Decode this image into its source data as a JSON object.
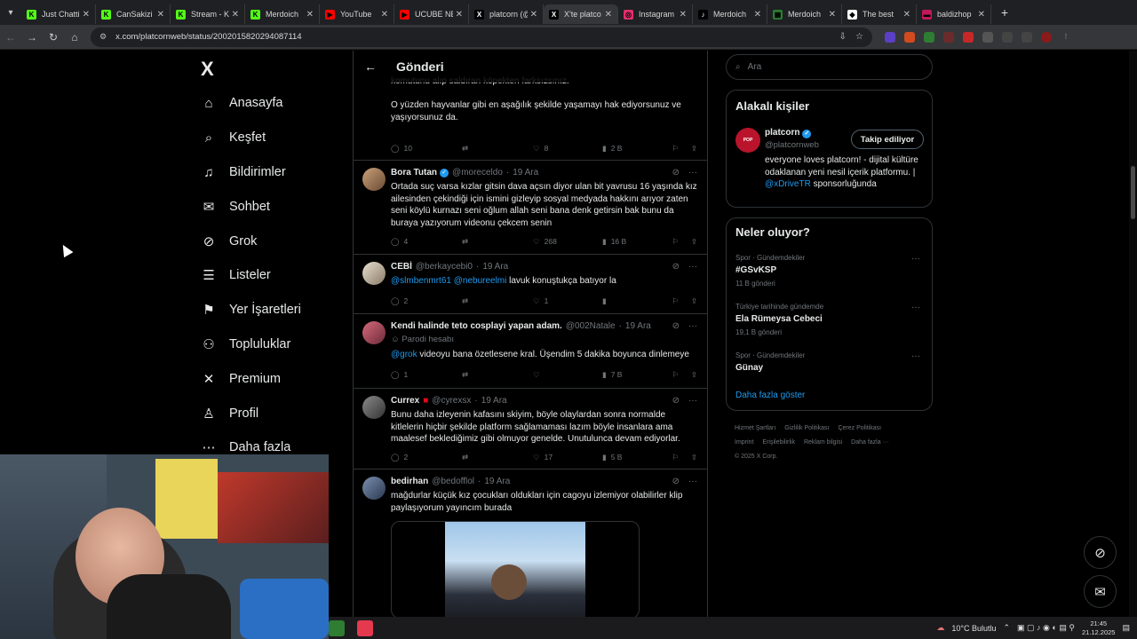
{
  "browser": {
    "tabs": [
      {
        "label": "Just Chatti",
        "color": "#53fc18",
        "icon": "K"
      },
      {
        "label": "CanSakizi",
        "color": "#53fc18",
        "icon": "K"
      },
      {
        "label": "Stream - K",
        "color": "#53fc18",
        "icon": "K"
      },
      {
        "label": "Merdoich",
        "color": "#53fc18",
        "icon": "K"
      },
      {
        "label": "YouTube",
        "color": "#ff0000",
        "icon": "▶"
      },
      {
        "label": "UCUBE NE",
        "color": "#ff0000",
        "icon": "▶"
      },
      {
        "label": "platcorn (@",
        "color": "#000000",
        "icon": "X"
      },
      {
        "label": "X'te platco",
        "color": "#000000",
        "icon": "X"
      },
      {
        "label": "Instagram",
        "color": "#e1306c",
        "icon": "◎"
      },
      {
        "label": "Merdoich",
        "color": "#000000",
        "icon": "♪"
      },
      {
        "label": "Merdoich",
        "color": "#2e7d32",
        "icon": "▦"
      },
      {
        "label": "The best",
        "color": "#ffffff",
        "icon": "◆"
      },
      {
        "label": "baldizhop",
        "color": "#c2185b",
        "icon": "▬"
      }
    ],
    "url": "x.com/platcornweb/status/2002015820294087114"
  },
  "nav": {
    "logo": "X",
    "items": [
      {
        "label": "Anasayfa",
        "icon": "home-icon",
        "glyph": "⌂"
      },
      {
        "label": "Keşfet",
        "icon": "search-icon",
        "glyph": "⌕"
      },
      {
        "label": "Bildirimler",
        "icon": "bell-icon",
        "glyph": "♫"
      },
      {
        "label": "Sohbet",
        "icon": "mail-icon",
        "glyph": "✉"
      },
      {
        "label": "Grok",
        "icon": "grok-icon",
        "glyph": "⊘"
      },
      {
        "label": "Listeler",
        "icon": "list-icon",
        "glyph": "☰"
      },
      {
        "label": "Yer İşaretleri",
        "icon": "bookmark-icon",
        "glyph": "⚑"
      },
      {
        "label": "Topluluklar",
        "icon": "communities-icon",
        "glyph": "⚇"
      },
      {
        "label": "Premium",
        "icon": "x-premium-icon",
        "glyph": "✕"
      },
      {
        "label": "Profil",
        "icon": "profile-icon",
        "glyph": "♙"
      },
      {
        "label": "Daha fazla",
        "icon": "more-icon",
        "glyph": "⋯"
      }
    ]
  },
  "main": {
    "header_title": "Gönderi",
    "prev_tweet_text": "komutunu alıp saldıran köpekten farksızsınız.\n\nO yüzden hayvanlar gibi en aşağılık şekilde yaşamayı hak ediyorsunuz ve yaşıyorsunuz da.",
    "prev_actions": {
      "replies": "10",
      "reposts": "",
      "likes": "8",
      "views": "2 B"
    },
    "tweets": [
      {
        "name": "Bora Tutan",
        "verified": true,
        "handle": "@moreceldo",
        "date": "19 Ara",
        "text": "Ortada suç varsa kızlar gitsin dava açsın diyor ulan bit yavrusu 16 yaşında kız ailesinden çekindiği için ismini gizleyip sosyal medyada hakkını arıyor zaten seni köylü kurnazı seni oğlum allah seni bana denk getirsin bak bunu da buraya yazıyorum videonu çekcem senin",
        "replies": "4",
        "reposts": "",
        "likes": "268",
        "views": "16 B"
      },
      {
        "name": "CEBİ",
        "verified": false,
        "handle": "@berkaycebi0",
        "date": "19 Ara",
        "mentions": "@slmbenmrt61 @nebureelmi",
        "text": " lavuk konuştukça batıyor la",
        "replies": "2",
        "reposts": "",
        "likes": "1",
        "views": ""
      },
      {
        "name": "Kendi halinde teto cosplayi yapan adam.",
        "verified": false,
        "handle": "@002Natale",
        "date": "19 Ara",
        "parody": "Parodi hesabı",
        "mentions": "@grok",
        "text": " videoyu bana özetlesene kral. Üşendim 5 dakika boyunca dinlemeye",
        "replies": "1",
        "reposts": "",
        "likes": "",
        "views": "7 B"
      },
      {
        "name": "Currex",
        "verified": false,
        "handle": "@cyrexsx",
        "date": "19 Ara",
        "text": "Bunu daha izleyenin kafasını skiyim, böyle olaylardan sonra normalde kitlelerin hiçbir şekilde platform sağlamaması lazım böyle insanlara ama maalesef beklediğimiz gibi olmuyor genelde. Unutulunca devam ediyorlar.",
        "replies": "2",
        "reposts": "",
        "likes": "17",
        "views": "5 B"
      },
      {
        "name": "bedirhan",
        "verified": false,
        "handle": "@bedofflol",
        "date": "19 Ara",
        "text": "mağdurlar küçük kız çocukları oldukları için cagoyu izlemiyor olabilirler klip paylaşıyorum yayıncım burada"
      }
    ]
  },
  "right": {
    "search_placeholder": "Ara",
    "related_title": "Alakalı kişiler",
    "person": {
      "name": "platcorn",
      "handle": "@platcornweb",
      "follow_label": "Takip ediliyor",
      "bio_a": "everyone loves platcorn! - dijital kültüre odaklanan yeni nesil içerik platformu. | ",
      "bio_mention": "@xDriveTR",
      "bio_b": " sponsorluğunda"
    },
    "trends_title": "Neler oluyor?",
    "trends": [
      {
        "context": "Spor · Gündemdekiler",
        "name": "#GSvKSP",
        "count": "11 B gönderi"
      },
      {
        "context": "Türkiye tarihinde gündemde",
        "name": "Ela Rümeysa Cebeci",
        "count": "19,1 B gönderi"
      },
      {
        "context": "Spor · Gündemdekiler",
        "name": "Günay",
        "count": ""
      }
    ],
    "show_more": "Daha fazla göster",
    "footer_line1": [
      "Hizmet Şartları",
      "Gizlilik Politikası",
      "Çerez Politikası"
    ],
    "footer_line2": [
      "Imprint",
      "Erişilebilirlik",
      "Reklam bilgisi",
      "Daha fazla ···"
    ],
    "copyright": "© 2025 X Corp."
  },
  "taskbar": {
    "weather": "10°C  Bulutlu",
    "time": "21:45",
    "date": "21.12.2025"
  },
  "colors": {
    "accent": "#1d9bf0",
    "bg": "#000000",
    "border": "#2f3336",
    "muted": "#71767b"
  }
}
